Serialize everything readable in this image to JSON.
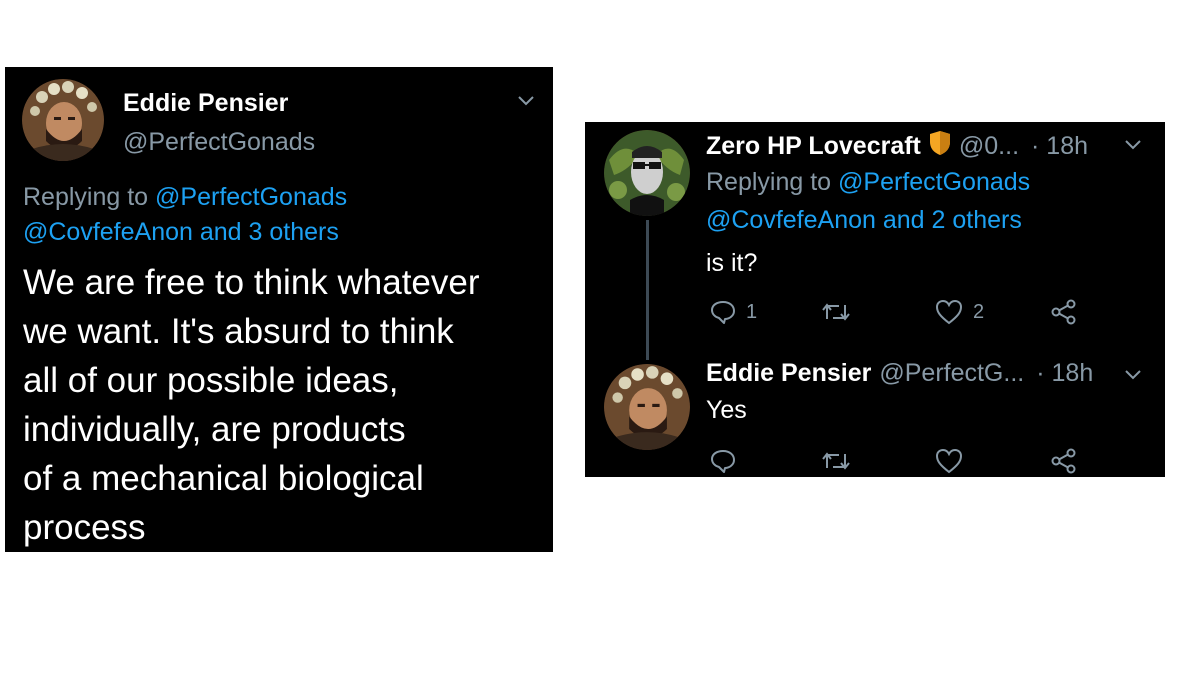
{
  "left_tweet": {
    "author_name": "Eddie Pensier",
    "author_handle": "@PerfectGonads",
    "replying_to_prefix": "Replying to",
    "replying_to_user": "@PerfectGonads",
    "replying_to_others": "@CovfefeAnon and 3 others",
    "body_lines": [
      "We are free to think whatever",
      "we want. It's absurd to think",
      "all of our possible ideas,",
      "individually, are products",
      "of a mechanical biological",
      "process"
    ]
  },
  "right_thread": {
    "first": {
      "author_name": "Zero HP Lovecraft",
      "author_handle": "@0...",
      "time": "· 18h",
      "replying_to_prefix": "Replying to",
      "replying_to_user": "@PerfectGonads",
      "replying_to_others": "@CovfefeAnon and 2 others",
      "body": "is it?",
      "reply_count": "1",
      "like_count": "2"
    },
    "second": {
      "author_name": "Eddie Pensier",
      "author_handle": "@PerfectG...",
      "time": "· 18h",
      "body": "Yes"
    }
  },
  "icons": {
    "reply": "reply-icon",
    "retweet": "retweet-icon",
    "like": "heart-icon",
    "share": "share-icon",
    "chevron": "chevron-down-icon",
    "badge": "shield-badge-icon"
  },
  "colors": {
    "background": "#000000",
    "text": "#ffffff",
    "secondary": "#8899a6",
    "link": "#1da1f2",
    "badge": "#f5a623"
  }
}
